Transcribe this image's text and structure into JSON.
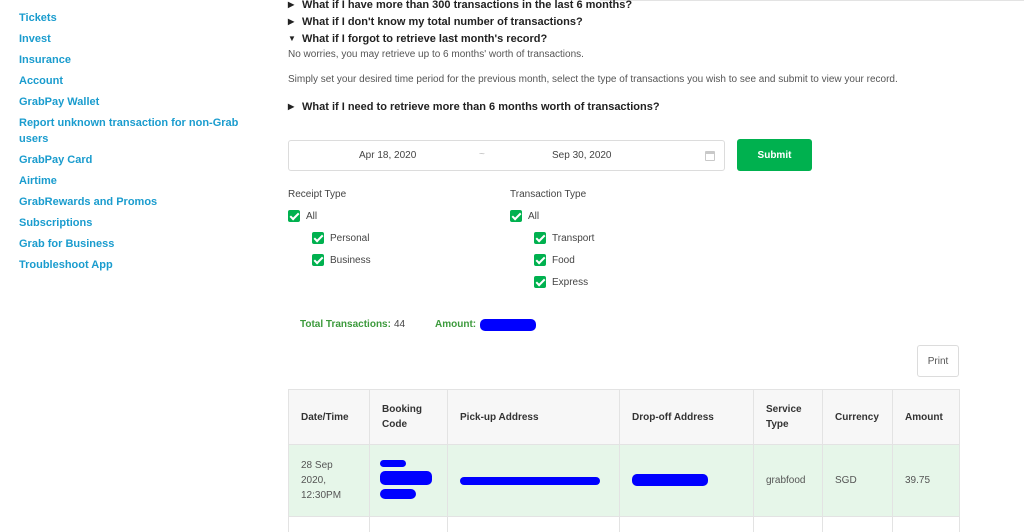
{
  "sidebar": {
    "items": [
      "Tickets",
      "Invest",
      "Insurance",
      "Account",
      "GrabPay Wallet",
      "Report unknown transaction for non-Grab users",
      "GrabPay Card",
      "Airtime",
      "GrabRewards and Promos",
      "Subscriptions",
      "Grab for Business",
      "Troubleshoot App"
    ]
  },
  "faq": {
    "q1": "What if I have more than 300 transactions in the last 6 months?",
    "q2": "What if I don't know my total number of transactions?",
    "q3": "What if I forgot to retrieve last month's record?",
    "a3_p1": "No worries, you may retrieve up to 6 months' worth of transactions.",
    "a3_p2": "Simply set your desired time period for the previous month, select the type of transactions you wish to see and submit to view your record.",
    "q4": "What if I need to retrieve more than 6 months worth of transactions?"
  },
  "date_range": {
    "start": "Apr 18, 2020",
    "separator": "~",
    "end": "Sep 30, 2020",
    "icon": "calendar-icon"
  },
  "submit_label": "Submit",
  "filters": {
    "receipt": {
      "title": "Receipt Type",
      "all": "All",
      "options": [
        "Personal",
        "Business"
      ],
      "checked": true
    },
    "transaction": {
      "title": "Transaction Type",
      "all": "All",
      "options": [
        "Transport",
        "Food",
        "Express"
      ],
      "checked": true
    }
  },
  "totals": {
    "transactions_label": "Total Transactions:",
    "transactions_value": "44",
    "amount_label": "Amount:"
  },
  "print_label": "Print",
  "table": {
    "headers": {
      "datetime": "Date/Time",
      "booking": "Booking Code",
      "pickup": "Pick-up Address",
      "dropoff": "Drop-off Address",
      "service": "Service Type",
      "currency": "Currency",
      "amount": "Amount"
    },
    "rows": [
      {
        "datetime": "28 Sep 2020, 12:30PM",
        "service": "grabfood",
        "currency": "SGD",
        "amount": "39.75"
      }
    ]
  },
  "colors": {
    "link": "#1a9cce",
    "brand_green": "#00b14f",
    "totals_green": "#3c9a3c",
    "row_highlight": "#e6f6e9",
    "redaction": "#0000ff"
  }
}
